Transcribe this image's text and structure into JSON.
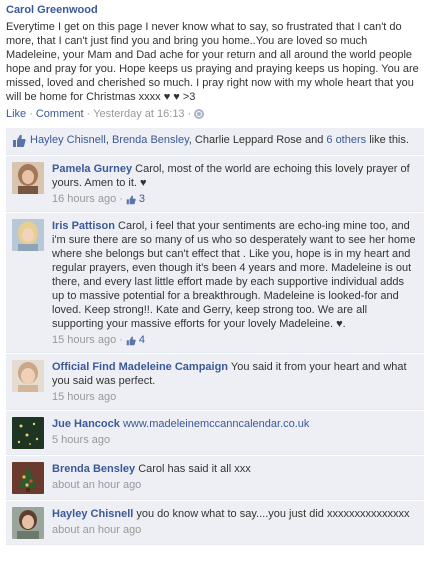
{
  "post": {
    "author": "Carol Greenwood",
    "text": "Everytime I get on this page I never know what to say, so frustrated that I can't do more, that I can't just find you and bring you home..You are loved so much Madeleine, your Mam and Dad ache for your return and all around the world people hope and pray for you. Hope keeps us praying and praying keeps us hoping. You are missed, loved and cherished so much. I pray right now with my whole heart that you will be home for Christmas xxxx ♥ ♥ >3",
    "actions": {
      "like": "Like",
      "comment": "Comment",
      "timestamp": "Yesterday at 16:13"
    },
    "icons": {
      "privacy": "globe-icon"
    }
  },
  "likes": {
    "icon": "thumbs-up-icon",
    "name1": "Hayley Chisnell",
    "separator1": ", ",
    "name2": "Brenda Bensley",
    "separator2": ", Charlie Leppard Rose and ",
    "others": "6 others",
    "suffix": " like this."
  },
  "comments": [
    {
      "author": "Pamela Gurney",
      "text": " Carol, most of the world are echoing this lovely prayer of yours. Amen to it. ♥",
      "time": "16 hours ago",
      "likes": "3",
      "avatar_color": "#a4765a"
    },
    {
      "author": "Iris Pattison",
      "text": " Carol, i feel that your sentiments are echo-ing mine too, and i'm sure there are so many of us who so desperately want to see her home where she belongs but can't effect that . Like you, hope is in my heart and regular prayers, even though it's been 4 years and more. Madeleine is out there, and every last little effort made by each supportive individual adds up to massive potential for a breakthrough. Madeleine is looked-for and loved. Keep strong!!. Kate and Gerry, keep strong too. We are all supporting your massive efforts for your lovely Madeleine. ♥.",
      "time": "15 hours ago",
      "likes": "4",
      "avatar_color": "#8fa3b7"
    },
    {
      "author": "Official Find Madeleine Campaign",
      "text": " You said it from your heart and what you said was perfect.",
      "time": "15 hours ago",
      "likes": "",
      "avatar_color": "#c9a889"
    },
    {
      "author": "Jue Hancock",
      "link": "www.madeleinemccanncalendar.co.uk",
      "time": "5 hours ago",
      "avatar_color": "#1e3524"
    },
    {
      "author": "Brenda Bensley",
      "text": " Carol has said it all xxx",
      "time": "about an hour ago",
      "avatar_color": "#6a3b2c"
    },
    {
      "author": "Hayley Chisnell",
      "text": " you do know what to say....you just did xxxxxxxxxxxxxxx",
      "time": "about an hour ago",
      "avatar_color": "#6c7a6e"
    }
  ],
  "colors": {
    "link": "#3b5998",
    "ufi_bg": "#edeff4",
    "meta": "#999999"
  }
}
